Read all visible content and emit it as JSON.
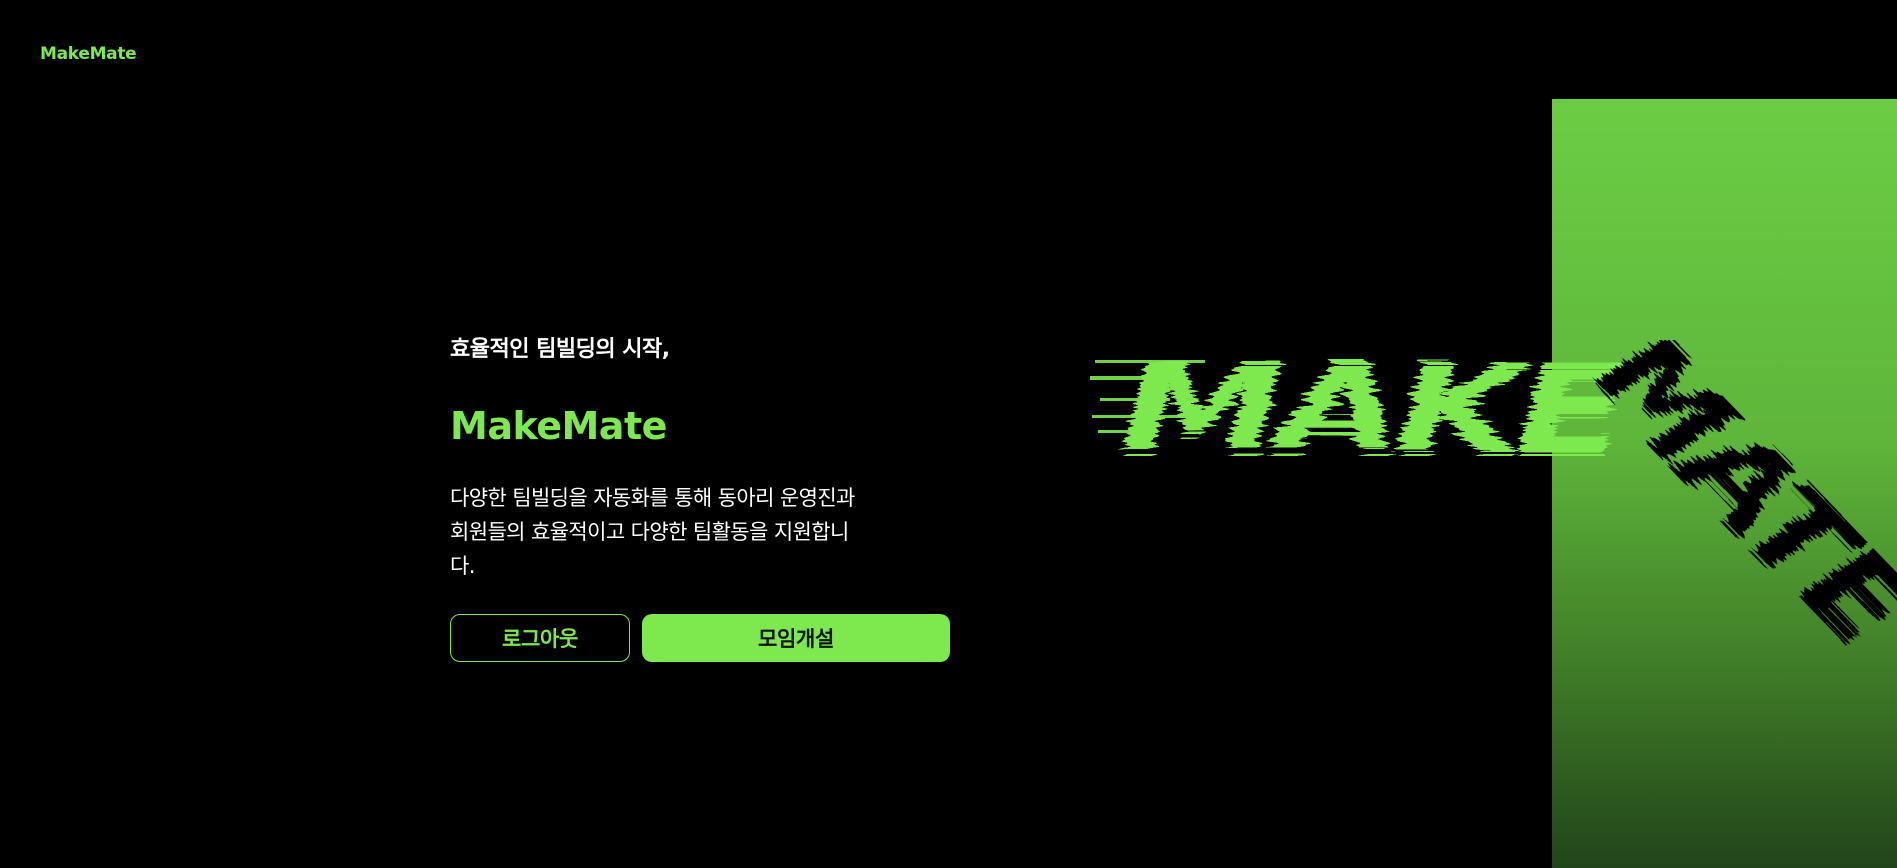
{
  "header": {
    "logo": "MakeMate"
  },
  "hero": {
    "tagline": "효율적인 팀빌딩의 시작,",
    "title": "MakeMate",
    "description_line1": "다양한 팀빌딩을 자동화를 통해 동아리 운영진과",
    "description_line2": "회원들의 효율적이고 다양한 팀활동을 지원합니",
    "description_line3": "다."
  },
  "buttons": {
    "logout_label": "로그아웃",
    "create_label": "모임개설"
  },
  "art": {
    "word_horizontal": "MAKE",
    "word_diagonal": "MATE"
  },
  "colors": {
    "accent": "#7ee84f",
    "background": "#000000",
    "panel_top": "#6ccd45",
    "panel_bottom": "#22441a"
  }
}
